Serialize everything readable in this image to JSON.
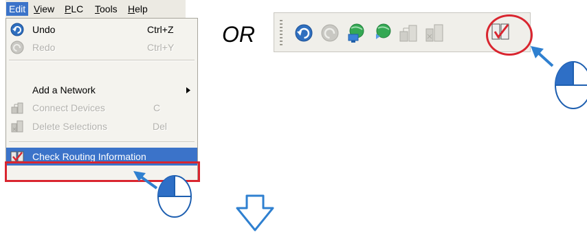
{
  "menubar": {
    "items": [
      {
        "label": "Edit",
        "active": true
      },
      {
        "label": "View",
        "accel_char": "V",
        "rest": "iew"
      },
      {
        "label": "PLC",
        "accel_char": "P",
        "rest": "LC"
      },
      {
        "label": "Tools",
        "accel_char": "T",
        "rest": "ools"
      },
      {
        "label": "Help",
        "accel_char": "H",
        "rest": "elp"
      }
    ]
  },
  "menu": {
    "items": [
      {
        "label": "Undo",
        "shortcut": "Ctrl+Z",
        "enabled": true,
        "icon": "undo-icon"
      },
      {
        "label": "Redo",
        "shortcut": "Ctrl+Y",
        "enabled": false,
        "icon": "redo-icon"
      },
      {
        "label": "Add a Network",
        "shortcut": "",
        "enabled": true,
        "submenu": true
      },
      {
        "label": "Connect Devices",
        "shortcut": "C",
        "enabled": false,
        "icon": "connect-devices-icon"
      },
      {
        "label": "Delete Selections",
        "shortcut": "Del",
        "enabled": false,
        "icon": "delete-selections-icon"
      },
      {
        "label": "Check Routing Information",
        "shortcut": "",
        "enabled": true,
        "highlighted": true,
        "icon": "check-routing-icon"
      }
    ]
  },
  "or_text": "OR",
  "toolbar": {
    "buttons": [
      "undo-icon",
      "redo-icon",
      "network-icon",
      "network-add-icon",
      "connect-devices-icon",
      "delete-selections-icon",
      "check-routing-icon"
    ]
  },
  "colors": {
    "highlight": "#3b73c9",
    "callout_red": "#d9252f",
    "arrow_blue": "#2f80d0",
    "mouse_fill": "#2e6fc6"
  }
}
